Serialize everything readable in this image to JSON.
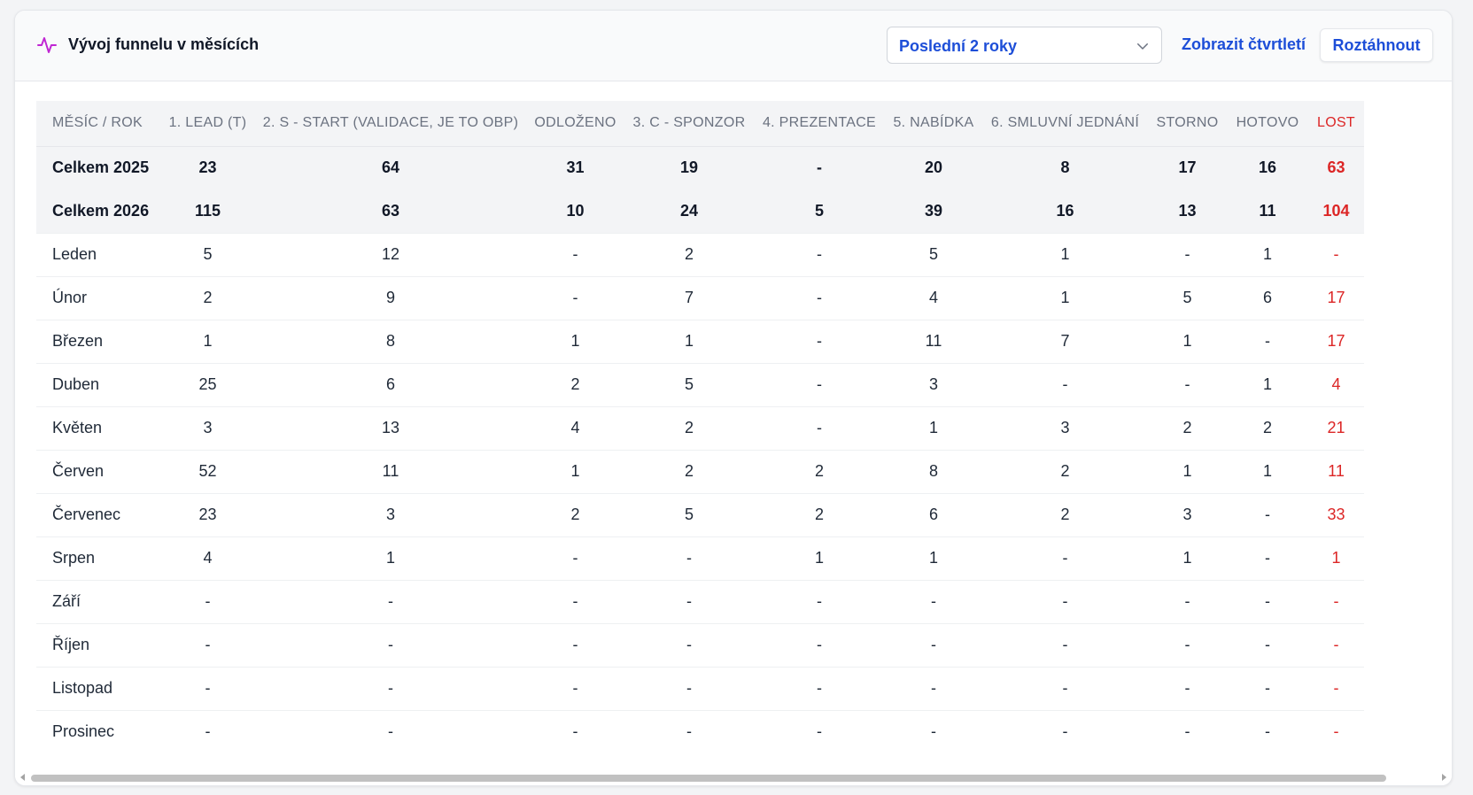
{
  "header": {
    "title": "Vývoj funnelu v měsících",
    "period_select": "Poslední 2 roky",
    "quarter_link": "Zobrazit čtvrtletí",
    "expand_button": "Roztáhnout"
  },
  "table": {
    "columns": [
      "MĚSÍC / ROK",
      "1. LEAD (T)",
      "2. S - START (VALIDACE, JE TO OBP)",
      "ODLOŽENO",
      "3. C - SPONZOR",
      "4. PREZENTACE",
      "5. NABÍDKA",
      "6. SMLUVNÍ JEDNÁNÍ",
      "STORNO",
      "HOTOVO",
      "LOST"
    ],
    "totals": [
      [
        "Celkem 2025",
        "23",
        "64",
        "31",
        "19",
        "-",
        "20",
        "8",
        "17",
        "16",
        "63"
      ],
      [
        "Celkem 2026",
        "115",
        "63",
        "10",
        "24",
        "5",
        "39",
        "16",
        "13",
        "11",
        "104"
      ]
    ],
    "rows": [
      [
        "Leden",
        "5",
        "12",
        "-",
        "2",
        "-",
        "5",
        "1",
        "-",
        "1",
        "-"
      ],
      [
        "Únor",
        "2",
        "9",
        "-",
        "7",
        "-",
        "4",
        "1",
        "5",
        "6",
        "17"
      ],
      [
        "Březen",
        "1",
        "8",
        "1",
        "1",
        "-",
        "11",
        "7",
        "1",
        "-",
        "17"
      ],
      [
        "Duben",
        "25",
        "6",
        "2",
        "5",
        "-",
        "3",
        "-",
        "-",
        "1",
        "4"
      ],
      [
        "Květen",
        "3",
        "13",
        "4",
        "2",
        "-",
        "1",
        "3",
        "2",
        "2",
        "21"
      ],
      [
        "Červen",
        "52",
        "11",
        "1",
        "2",
        "2",
        "8",
        "2",
        "1",
        "1",
        "11"
      ],
      [
        "Červenec",
        "23",
        "3",
        "2",
        "5",
        "2",
        "6",
        "2",
        "3",
        "-",
        "33"
      ],
      [
        "Srpen",
        "4",
        "1",
        "-",
        "-",
        "1",
        "1",
        "-",
        "1",
        "-",
        "1"
      ],
      [
        "Září",
        "-",
        "-",
        "-",
        "-",
        "-",
        "-",
        "-",
        "-",
        "-",
        "-"
      ],
      [
        "Říjen",
        "-",
        "-",
        "-",
        "-",
        "-",
        "-",
        "-",
        "-",
        "-",
        "-"
      ],
      [
        "Listopad",
        "-",
        "-",
        "-",
        "-",
        "-",
        "-",
        "-",
        "-",
        "-",
        "-"
      ],
      [
        "Prosinec",
        "-",
        "-",
        "-",
        "-",
        "-",
        "-",
        "-",
        "-",
        "-",
        "-"
      ]
    ]
  },
  "colors": {
    "accent": "#1d4ed8",
    "lost": "#dc2626",
    "icon": "#c026d3"
  }
}
